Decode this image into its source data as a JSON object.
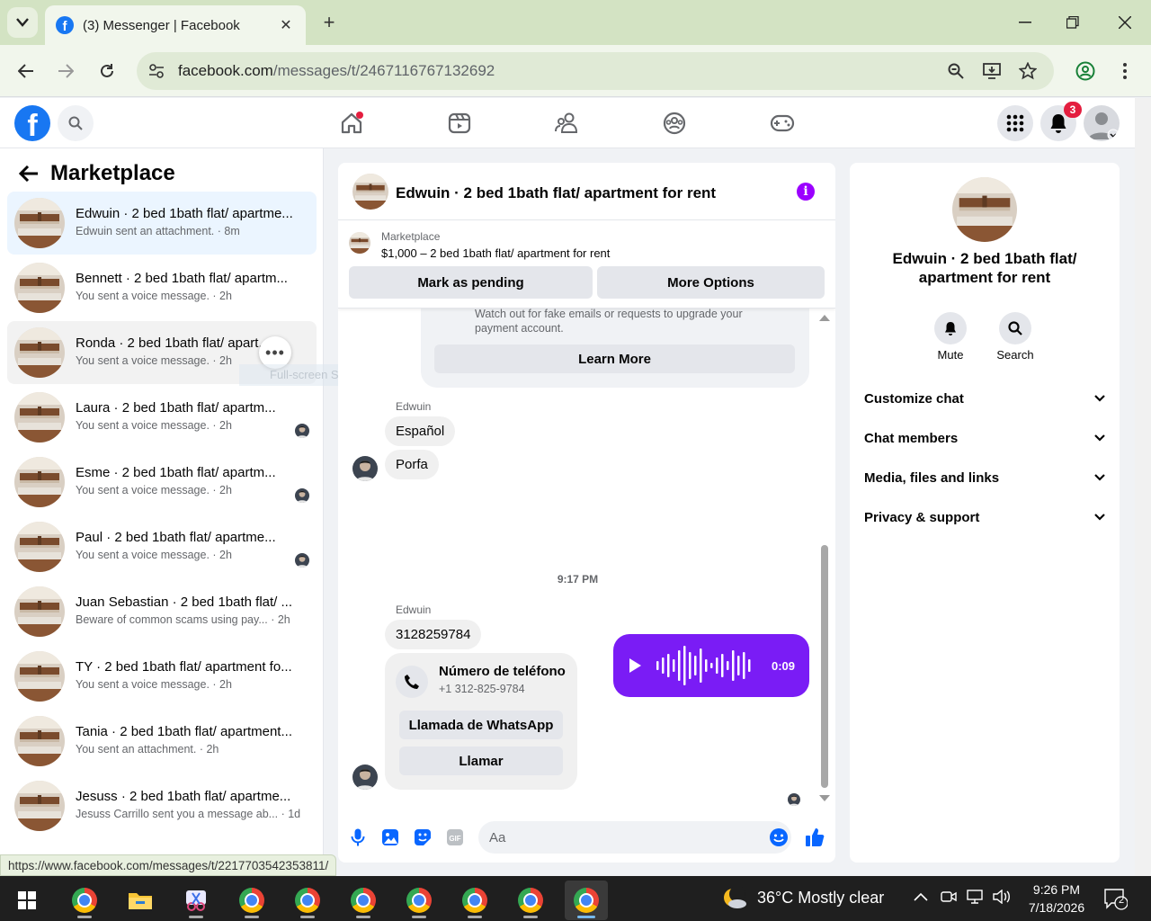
{
  "browser": {
    "tab_title": "(3) Messenger | Facebook",
    "url_host": "facebook.com",
    "url_path": "/messages/t/2467116767132692",
    "status_url": "https://www.facebook.com/messages/t/2217703542353811/"
  },
  "fb": {
    "notification_count": "3"
  },
  "sidebar": {
    "title": "Marketplace",
    "conversations": [
      {
        "name": "Edwuin · 2 bed 1bath flat/ apartme...",
        "preview": "Edwuin sent an attachment. · 8m"
      },
      {
        "name": "Bennett · 2 bed 1bath flat/ apartm...",
        "preview": "You sent a voice message. · 2h"
      },
      {
        "name": "Ronda · 2 bed 1bath flat/ apart...",
        "preview": "You sent a voice message. · 2h"
      },
      {
        "name": "Laura · 2 bed 1bath flat/ apartm...",
        "preview": "You sent a voice message. · 2h"
      },
      {
        "name": "Esme · 2 bed 1bath flat/ apartm...",
        "preview": "You sent a voice message. · 2h"
      },
      {
        "name": "Paul · 2 bed 1bath flat/ apartme...",
        "preview": "You sent a voice message. · 2h"
      },
      {
        "name": "Juan Sebastian · 2 bed 1bath flat/ ...",
        "preview": "Beware of common scams using pay... · 2h"
      },
      {
        "name": "TY · 2 bed 1bath flat/ apartment fo...",
        "preview": "You sent a voice message. · 2h"
      },
      {
        "name": "Tania · 2 bed 1bath flat/ apartment...",
        "preview": "You sent an attachment. · 2h"
      },
      {
        "name": "Jesuss · 2 bed 1bath flat/ apartme...",
        "preview": "Jesuss Carrillo sent you a message ab... · 1d"
      }
    ],
    "snip_ghost": "Full-screen Snip"
  },
  "chat": {
    "title": "Edwuin · 2 bed 1bath flat/ apartment for rent",
    "marketplace_label": "Marketplace",
    "listing": "$1,000 – 2 bed 1bath flat/ apartment for rent",
    "mark_pending": "Mark as pending",
    "more_options": "More Options",
    "warning_text": "Watch out for fake emails or requests to upgrade your payment account.",
    "learn_more": "Learn More",
    "sender_1": "Edwuin",
    "msg_espanol": "Español",
    "msg_porfa": "Porfa",
    "voice_duration": "0:09",
    "time_sep": "9:17 PM",
    "sender_2": "Edwuin",
    "msg_number": "3128259784",
    "phone_card_title": "Número de teléfono",
    "phone_card_number": "+1 312-825-9784",
    "whatsapp_call": "Llamada de WhatsApp",
    "call": "Llamar",
    "composer_placeholder": "Aa"
  },
  "details": {
    "name": "Edwuin · 2 bed 1bath flat/ apartment for rent",
    "mute": "Mute",
    "search": "Search",
    "sections": [
      "Customize chat",
      "Chat members",
      "Media, files and links",
      "Privacy & support"
    ]
  },
  "taskbar": {
    "weather": "36°C  Mostly clear",
    "time": "9:26 PM",
    "date": "7/18/2026",
    "notifications": "2"
  },
  "colors": {
    "accent": "#1877f2",
    "messenger_purple": "#7a1cf5",
    "badge_red": "#e41e3f"
  }
}
